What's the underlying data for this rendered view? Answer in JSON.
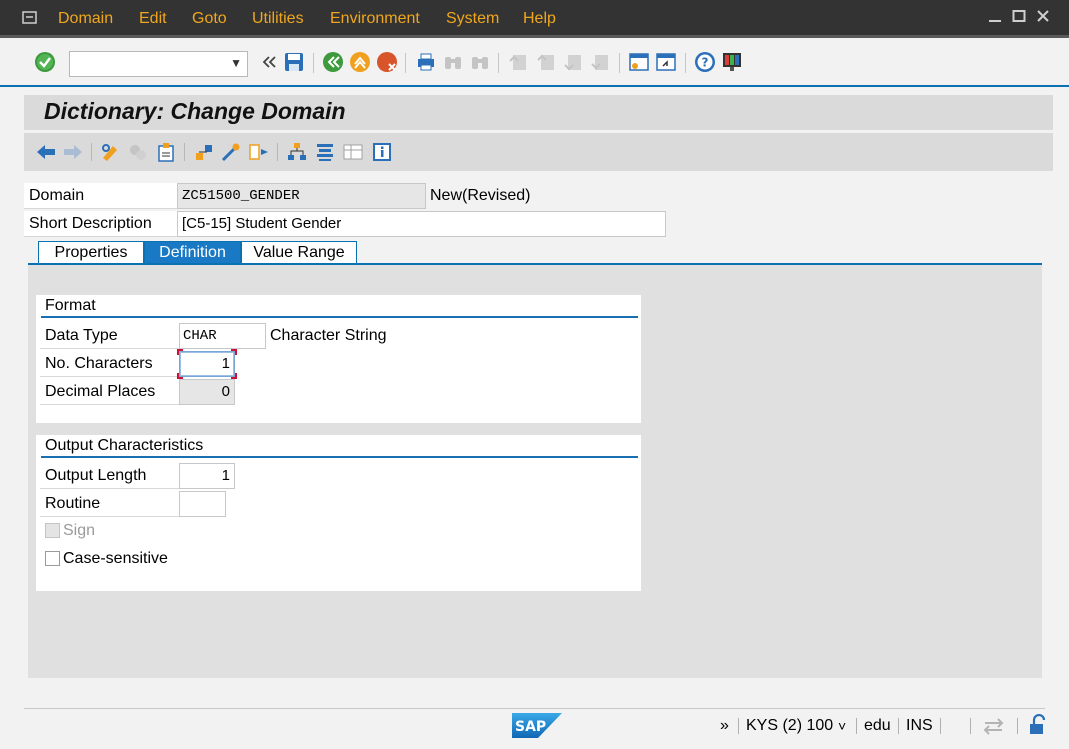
{
  "menu": {
    "items": [
      "Domain",
      "Edit",
      "Goto",
      "Utilities",
      "Environment",
      "System",
      "Help"
    ]
  },
  "toolbar": {
    "command_value": "",
    "icons": [
      "enter-icon",
      "back-icon",
      "save-icon",
      "back-green-icon",
      "exit-icon",
      "cancel-icon",
      "print-icon",
      "find-icon",
      "find-next-icon",
      "first-page-icon",
      "previous-page-icon",
      "next-page-icon",
      "last-page-icon",
      "create-session-icon",
      "shortcut-icon",
      "help-icon",
      "customize-layout-icon"
    ]
  },
  "title": "Dictionary: Change Domain",
  "header": {
    "domain_label": "Domain",
    "domain_value": "ZC51500_GENDER",
    "domain_status": "New(Revised)",
    "short_desc_label": "Short Description",
    "short_desc_value": "[C5-15] Student Gender"
  },
  "tabs": [
    {
      "label": "Properties",
      "active": false
    },
    {
      "label": "Definition",
      "active": true
    },
    {
      "label": "Value Range",
      "active": false
    }
  ],
  "format": {
    "title": "Format",
    "data_type_label": "Data Type",
    "data_type_value": "CHAR",
    "data_type_desc": "Character String",
    "no_chars_label": "No. Characters",
    "no_chars_value": "1",
    "decimals_label": "Decimal Places",
    "decimals_value": "0"
  },
  "output": {
    "title": "Output Characteristics",
    "length_label": "Output Length",
    "length_value": "1",
    "routine_label": "Routine",
    "routine_value": "",
    "sign_label": "Sign",
    "case_label": "Case-sensitive"
  },
  "status": {
    "more": "»",
    "system": "KYS (2) 100",
    "client_arrow": "˅",
    "server": "edu",
    "mode": "INS"
  },
  "colors": {
    "menu_bg": "#333333",
    "menu_text": "#f0a71e",
    "accent_blue": "#0a71b3",
    "active_tab": "#1979c4"
  }
}
